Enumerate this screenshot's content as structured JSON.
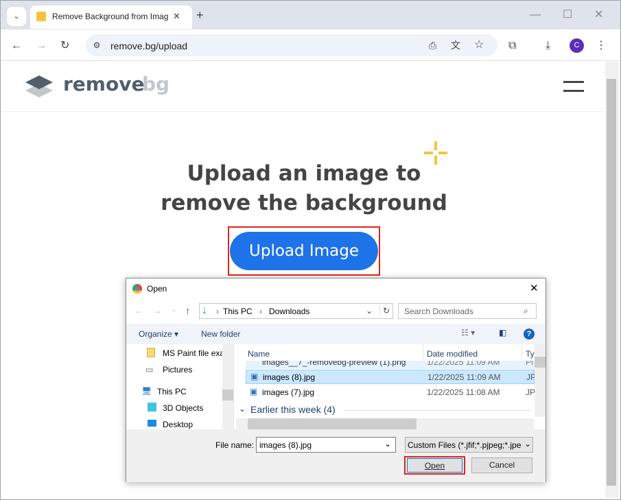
{
  "browser": {
    "tab_title": "Remove Background from Imag",
    "url": "remove.bg/upload",
    "profile_initial": "C",
    "accent": "#1f73e8"
  },
  "site": {
    "logo_remove": "remove",
    "logo_bg": "bg",
    "headline_line1": "Upload an image to",
    "headline_line2": "remove the background",
    "upload_button": "Upload Image"
  },
  "dialog": {
    "title": "Open",
    "path": [
      "This PC",
      "Downloads"
    ],
    "search_placeholder": "Search Downloads",
    "organize": "Organize",
    "new_folder": "New folder",
    "nav": [
      {
        "label": "MS Paint file exa",
        "icon": "folder-icon"
      },
      {
        "label": "Pictures",
        "icon": "pictures-icon"
      },
      {
        "label": "This PC",
        "icon": "computer-icon"
      },
      {
        "label": "3D Objects",
        "icon": "cube-icon"
      },
      {
        "label": "Desktop",
        "icon": "desktop-icon"
      }
    ],
    "columns": [
      "Name",
      "Date modified",
      "Ty"
    ],
    "files": [
      {
        "name": "images__7_-removebg-preview (1).png",
        "date": "1/22/2025 11:09 AM",
        "type": "PI"
      },
      {
        "name": "images (8).jpg",
        "date": "1/22/2025 11:09 AM",
        "type": "JP",
        "selected": true
      },
      {
        "name": "images (7).jpg",
        "date": "1/22/2025 11:08 AM",
        "type": "JP"
      }
    ],
    "group": "Earlier this week (4)",
    "file_name_label": "File name:",
    "file_name_value": "images (8).jpg",
    "filter": "Custom Files (*.jfif;*.pjpeg;*.jpe",
    "open": "Open",
    "cancel": "Cancel"
  }
}
